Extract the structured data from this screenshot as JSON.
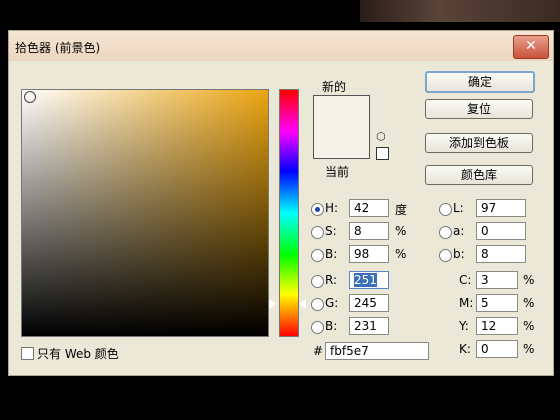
{
  "window": {
    "title": "拾色器 (前景色)",
    "close": "✕"
  },
  "swatch": {
    "new_label": "新的",
    "current_label": "当前",
    "color": "#f5f2ea"
  },
  "buttons": {
    "ok": "确定",
    "reset": "复位",
    "add_to_swatches": "添加到色板",
    "color_libraries": "颜色库"
  },
  "hsb": {
    "h_label": "H:",
    "h_value": "42",
    "h_unit": "度",
    "s_label": "S:",
    "s_value": "8",
    "s_unit": "%",
    "b_label": "B:",
    "b_value": "98",
    "b_unit": "%"
  },
  "rgb": {
    "r_label": "R:",
    "r_value": "251",
    "g_label": "G:",
    "g_value": "245",
    "b_label": "B:",
    "b_value": "231"
  },
  "lab": {
    "l_label": "L:",
    "l_value": "97",
    "a_label": "a:",
    "a_value": "0",
    "b_label": "b:",
    "b_value": "8"
  },
  "cmyk": {
    "c_label": "C:",
    "c_value": "3",
    "c_unit": "%",
    "m_label": "M:",
    "m_value": "5",
    "m_unit": "%",
    "y_label": "Y:",
    "y_value": "12",
    "y_unit": "%",
    "k_label": "K:",
    "k_value": "0",
    "k_unit": "%"
  },
  "hex": {
    "label": "#",
    "value": "fbf5e7"
  },
  "web_only": {
    "label": "只有 Web 颜色",
    "checked": false
  },
  "icons": {
    "close": "close-icon",
    "cube": "cube-icon",
    "web_safe": "web-safe-swatch-icon"
  }
}
